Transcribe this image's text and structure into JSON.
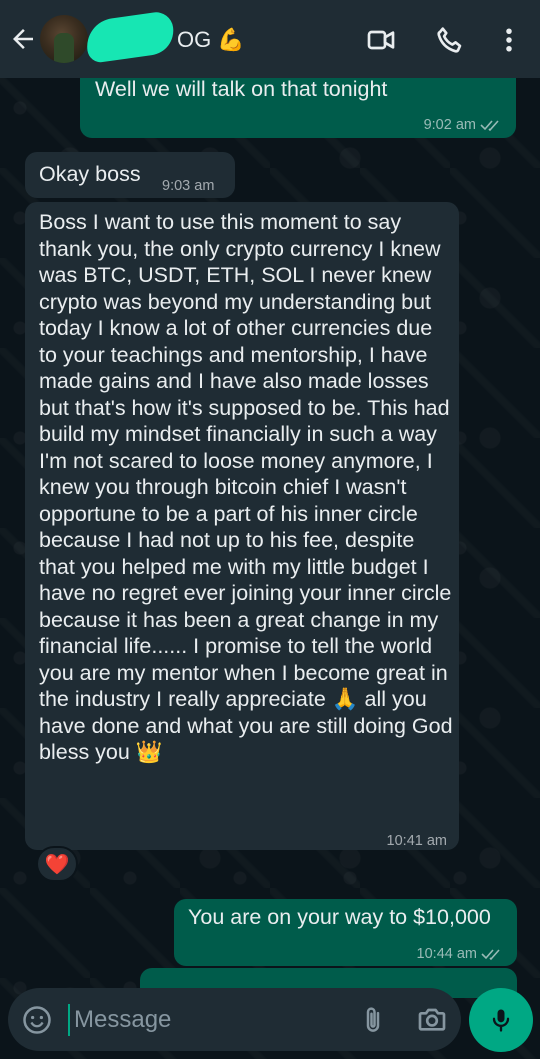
{
  "header": {
    "contact_name": "OG 💪",
    "back_icon": "arrow-left-icon",
    "video_icon": "video-call-icon",
    "call_icon": "phone-icon",
    "menu_icon": "more-vertical-icon"
  },
  "messages": [
    {
      "direction": "outgoing",
      "text": "Well we will talk on that tonight",
      "time": "9:02 am",
      "status": "read"
    },
    {
      "direction": "incoming",
      "text": "Okay boss",
      "time": "9:03 am"
    },
    {
      "direction": "incoming",
      "text": "Boss I want to use this moment to say thank you, the only crypto currency I knew was BTC, USDT, ETH, SOL I never knew crypto was beyond my understanding but today I know a lot of other currencies due to your teachings and mentorship, I have made gains and I have also made losses but that's how it's supposed to be. This had build my mindset financially in such a way I'm not scared to loose money anymore, I knew you through bitcoin chief I wasn't opportune to be a part of his inner circle because I had not up to his fee, despite that you helped me with my little budget I have no regret ever joining your inner circle because it has been a great change in my financial life...... I promise to tell the world you are my mentor when I become great in the industry I really appreciate 🙏 all you have done and what you are still doing God bless you 👑",
      "time": "10:41 am",
      "reaction": "❤️"
    },
    {
      "direction": "outgoing",
      "text": "You are on your way to $10,000",
      "time": "10:44 am",
      "status": "read"
    }
  ],
  "composer": {
    "placeholder": "Message",
    "emoji_icon": "emoji-icon",
    "attach_icon": "paperclip-icon",
    "camera_icon": "camera-icon",
    "mic_icon": "microphone-icon"
  },
  "colors": {
    "background": "#0b141a",
    "header": "#1f2c34",
    "outgoing_bubble": "#005c4b",
    "incoming_bubble": "#1f2c34",
    "accent": "#00a884"
  }
}
